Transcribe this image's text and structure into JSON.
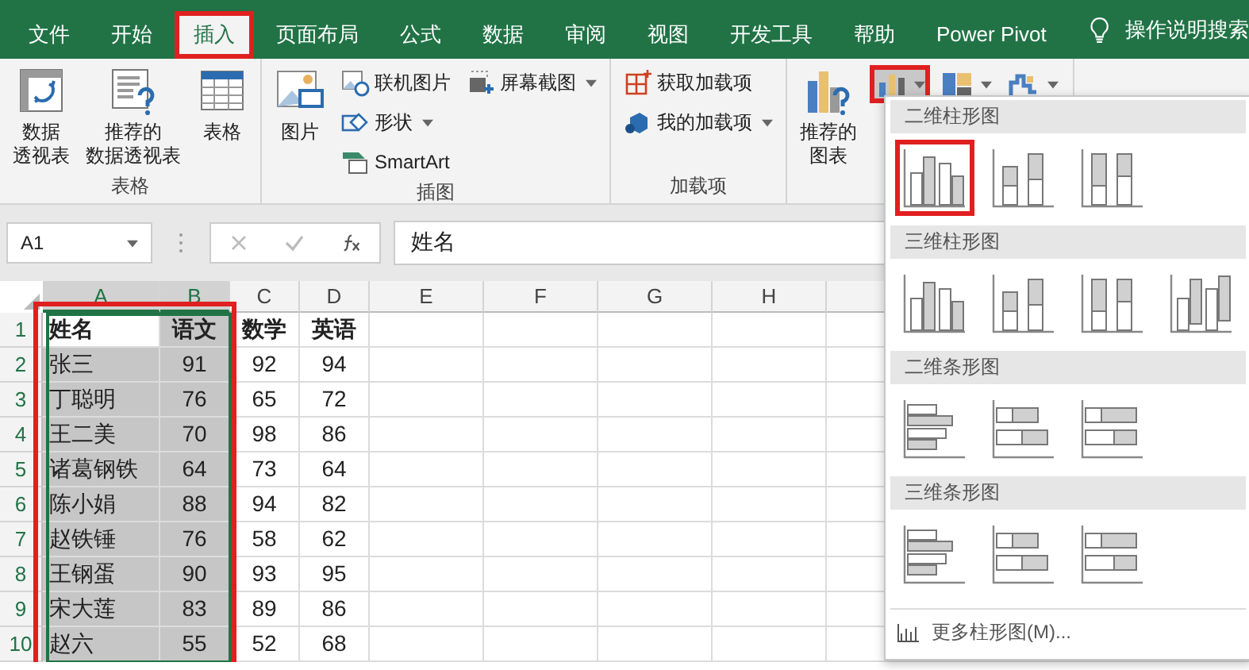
{
  "tabs": [
    {
      "label": "文件",
      "selected": false,
      "outlined": false
    },
    {
      "label": "开始",
      "selected": false,
      "outlined": false
    },
    {
      "label": "插入",
      "selected": true,
      "outlined": true
    },
    {
      "label": "页面布局",
      "selected": false,
      "outlined": false
    },
    {
      "label": "公式",
      "selected": false,
      "outlined": false
    },
    {
      "label": "数据",
      "selected": false,
      "outlined": false
    },
    {
      "label": "审阅",
      "selected": false,
      "outlined": false
    },
    {
      "label": "视图",
      "selected": false,
      "outlined": false
    },
    {
      "label": "开发工具",
      "selected": false,
      "outlined": false
    },
    {
      "label": "帮助",
      "selected": false,
      "outlined": false
    },
    {
      "label": "Power Pivot",
      "selected": false,
      "outlined": false
    }
  ],
  "search": {
    "label": "操作说明搜索"
  },
  "ribbon": {
    "groups": [
      {
        "label": "表格",
        "columns": [
          [
            {
              "kind": "large",
              "lines": [
                "数据",
                "透视表"
              ]
            }
          ],
          [
            {
              "kind": "large",
              "lines": [
                "推荐的",
                "数据透视表"
              ]
            }
          ],
          [
            {
              "kind": "large",
              "lines": [
                "表格"
              ]
            }
          ]
        ]
      },
      {
        "label": "插图",
        "columns": [
          [
            {
              "kind": "large",
              "lines": [
                "图片"
              ]
            }
          ],
          [
            {
              "kind": "small",
              "lines": [
                "联机图片"
              ],
              "dropdown": false
            },
            {
              "kind": "small",
              "lines": [
                "形状"
              ],
              "dropdown": true
            },
            {
              "kind": "small",
              "lines": [
                "SmartArt"
              ],
              "dropdown": false
            }
          ],
          [
            {
              "kind": "small",
              "lines": [
                "屏幕截图"
              ],
              "dropdown": true
            }
          ]
        ]
      },
      {
        "label": "加载项",
        "columns": [
          [
            {
              "kind": "small",
              "lines": [
                "获取加载项"
              ],
              "dropdown": false
            },
            {
              "kind": "small",
              "lines": [
                "我的加载项"
              ],
              "dropdown": true
            }
          ]
        ]
      },
      {
        "columns": [
          [
            {
              "kind": "large",
              "lines": [
                "推荐的",
                "图表"
              ]
            }
          ],
          [
            {
              "kind": "chart",
              "outlined": true
            },
            {
              "kind": "chart",
              "outlined": false
            },
            {
              "kind": "chart",
              "outlined": false
            }
          ]
        ]
      }
    ]
  },
  "formula_bar": {
    "name_box": "A1",
    "formula": "姓名"
  },
  "sheet": {
    "columns": [
      {
        "label": "A",
        "selected": true
      },
      {
        "label": "B",
        "selected": true
      },
      {
        "label": "C",
        "selected": false
      },
      {
        "label": "D",
        "selected": false
      },
      {
        "label": "E",
        "selected": false
      },
      {
        "label": "F",
        "selected": false
      },
      {
        "label": "G",
        "selected": false
      },
      {
        "label": "H",
        "selected": false
      }
    ],
    "outlined": true,
    "rows": [
      {
        "number": "1",
        "cells": [
          "姓名",
          "语文",
          "数学",
          "英语"
        ]
      },
      {
        "number": "2",
        "cells": [
          "张三",
          "91",
          "92",
          "94"
        ]
      },
      {
        "number": "3",
        "cells": [
          "丁聪明",
          "76",
          "65",
          "72"
        ]
      },
      {
        "number": "4",
        "cells": [
          "王二美",
          "70",
          "98",
          "86"
        ]
      },
      {
        "number": "5",
        "cells": [
          "诸葛钢铁",
          "64",
          "73",
          "64"
        ]
      },
      {
        "number": "6",
        "cells": [
          "陈小娟",
          "88",
          "94",
          "82"
        ]
      },
      {
        "number": "7",
        "cells": [
          "赵铁锤",
          "76",
          "58",
          "62"
        ]
      },
      {
        "number": "8",
        "cells": [
          "王钢蛋",
          "90",
          "93",
          "95"
        ]
      },
      {
        "number": "9",
        "cells": [
          "宋大莲",
          "83",
          "89",
          "86"
        ]
      },
      {
        "number": "10",
        "cells": [
          "赵六",
          "55",
          "52",
          "68"
        ]
      }
    ]
  },
  "chart_menu": {
    "sections": [
      {
        "title": "二维柱形图",
        "items": [
          {
            "outlined": true
          },
          {
            "outlined": false
          },
          {
            "outlined": false
          }
        ]
      },
      {
        "title": "三维柱形图",
        "items": [
          {
            "outlined": false
          },
          {
            "outlined": false
          },
          {
            "outlined": false
          },
          {
            "outlined": false
          }
        ]
      },
      {
        "title": "二维条形图",
        "items": [
          {
            "outlined": false
          },
          {
            "outlined": false
          },
          {
            "outlined": false
          }
        ]
      },
      {
        "title": "三维条形图",
        "items": [
          {
            "outlined": false
          },
          {
            "outlined": false
          },
          {
            "outlined": false
          }
        ]
      }
    ],
    "more": "更多柱形图(M)..."
  }
}
